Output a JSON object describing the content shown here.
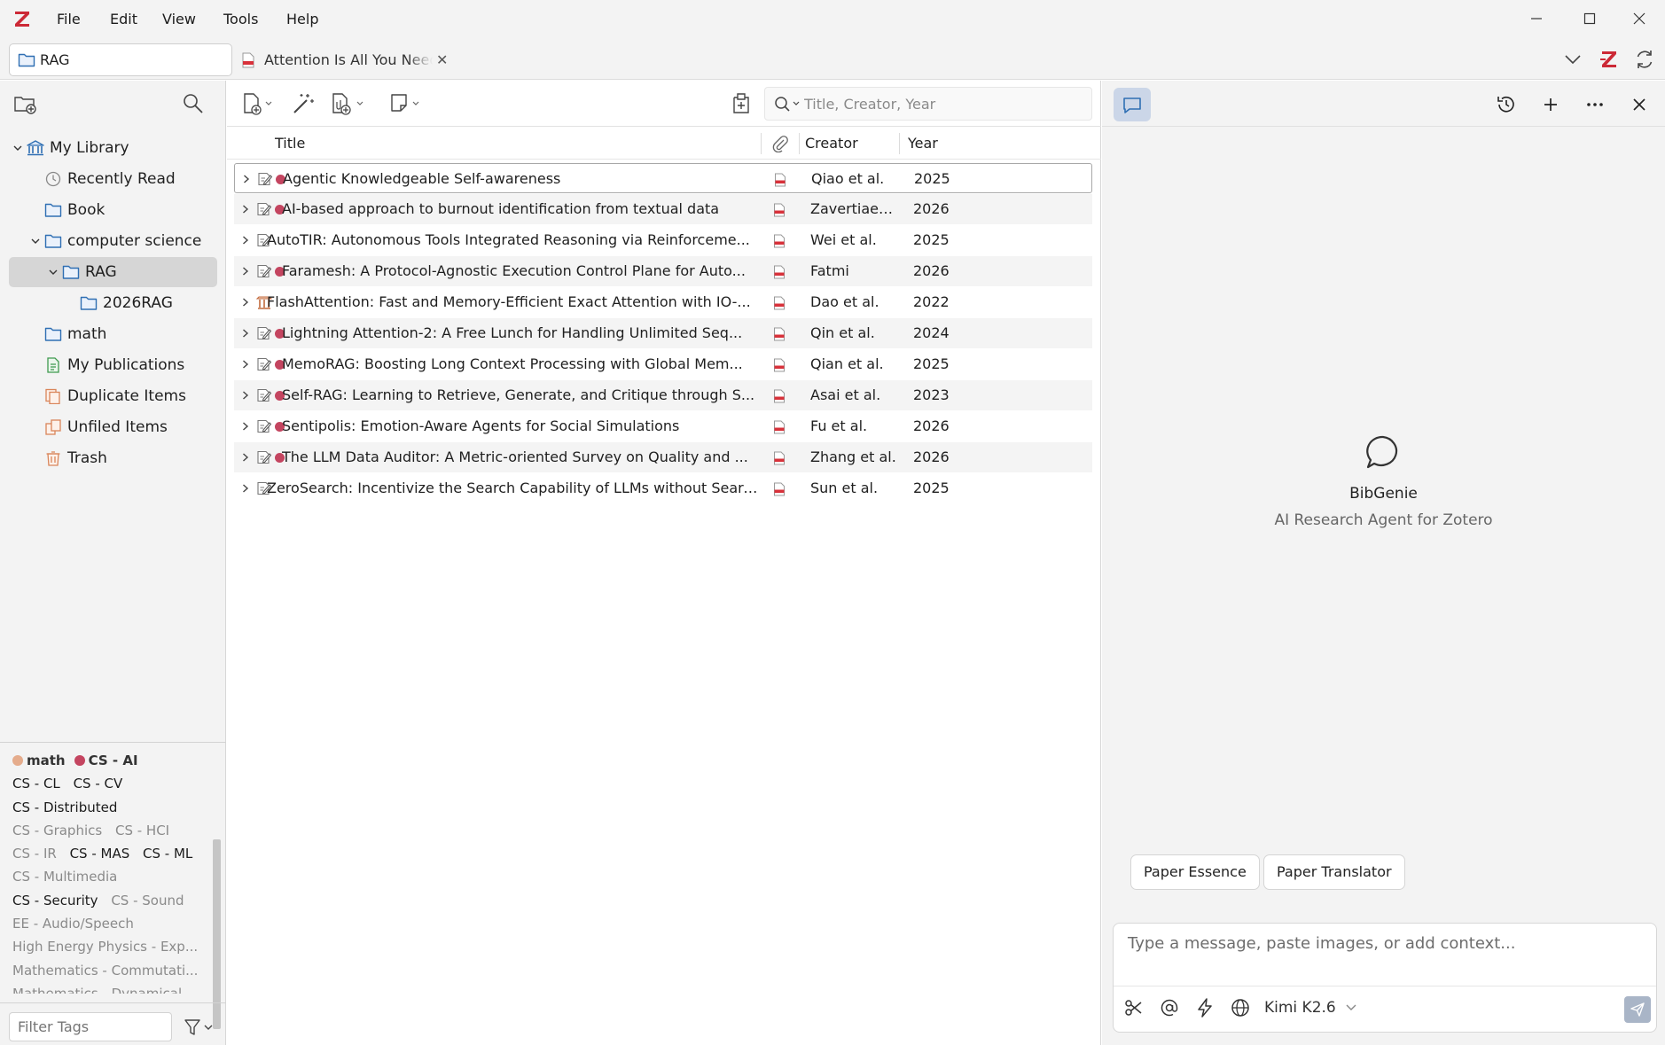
{
  "app": {
    "menus": [
      "File",
      "Edit",
      "View",
      "Tools",
      "Help"
    ]
  },
  "tabs": {
    "library_tab": "RAG",
    "reader_tab": "Attention Is All You Need",
    "reader_close": "✕"
  },
  "collections": [
    {
      "label": "My Library",
      "icon": "library-icon",
      "twisty": "expanded"
    },
    {
      "label": "Recently Read",
      "icon": "clock-icon"
    },
    {
      "label": "Book",
      "icon": "folder-icon"
    },
    {
      "label": "computer science",
      "icon": "folder-icon",
      "twisty": "expanded"
    },
    {
      "label": "RAG",
      "icon": "folder-icon",
      "twisty": "expanded",
      "selected": true
    },
    {
      "label": "2026RAG",
      "icon": "folder-icon"
    },
    {
      "label": "math",
      "icon": "folder-icon"
    },
    {
      "label": "My Publications",
      "icon": "publications-icon"
    },
    {
      "label": "Duplicate Items",
      "icon": "duplicate-icon"
    },
    {
      "label": "Unfiled Items",
      "icon": "unfiled-icon"
    },
    {
      "label": "Trash",
      "icon": "trash-icon"
    }
  ],
  "tags": {
    "colored": [
      {
        "label": "math",
        "color": "#e5ac8c"
      },
      {
        "label": "CS - AI",
        "color": "#c44560"
      }
    ],
    "items": [
      {
        "label": "CS - CL",
        "state": "on"
      },
      {
        "label": "CS - CV",
        "state": "on"
      },
      {
        "label": "CS - Distributed",
        "state": "on"
      },
      {
        "label": "CS - Graphics",
        "state": "off"
      },
      {
        "label": "CS - HCI",
        "state": "off"
      },
      {
        "label": "CS - IR",
        "state": "off"
      },
      {
        "label": "CS - MAS",
        "state": "on"
      },
      {
        "label": "CS - ML",
        "state": "on"
      },
      {
        "label": "CS - Multimedia",
        "state": "off"
      },
      {
        "label": "CS - Security",
        "state": "on"
      },
      {
        "label": "CS - Sound",
        "state": "off"
      },
      {
        "label": "EE - Audio/Speech",
        "state": "off"
      },
      {
        "label": "High Energy Physics - Exp...",
        "state": "off"
      },
      {
        "label": "Mathematics - Commutati...",
        "state": "off"
      },
      {
        "label": "Mathematics - Dynamical",
        "state": "off"
      }
    ],
    "filter_placeholder": "Filter Tags"
  },
  "search": {
    "placeholder": "Title, Creator, Year"
  },
  "columns": {
    "title": "Title",
    "creator": "Creator",
    "year": "Year"
  },
  "items": [
    {
      "title": "Agentic Knowledgeable Self-awareness",
      "creator": "Qiao et al.",
      "year": "2025",
      "tag_color": "#c44560",
      "type": "preprint"
    },
    {
      "title": "AI-based approach to burnout identification from textual data",
      "creator": "Zavertiaev...",
      "year": "2026",
      "tag_color": "#c44560",
      "type": "preprint"
    },
    {
      "title": "AutoTIR: Autonomous Tools Integrated Reasoning via Reinforceme...",
      "creator": "Wei et al.",
      "year": "2025",
      "tag_color": null,
      "type": "preprint"
    },
    {
      "title": "Faramesh: A Protocol-Agnostic Execution Control Plane for Auto...",
      "creator": "Fatmi",
      "year": "2026",
      "tag_color": "#c44560",
      "type": "preprint"
    },
    {
      "title": "FlashAttention: Fast and Memory-Efficient Exact Attention with IO-...",
      "creator": "Dao et al.",
      "year": "2022",
      "tag_color": null,
      "type": "conference"
    },
    {
      "title": "Lightning Attention-2: A Free Lunch for Handling Unlimited Seq...",
      "creator": "Qin et al.",
      "year": "2024",
      "tag_color": "#c44560",
      "type": "preprint"
    },
    {
      "title": "MemoRAG: Boosting Long Context Processing with Global Mem...",
      "creator": "Qian et al.",
      "year": "2025",
      "tag_color": "#c44560",
      "type": "preprint"
    },
    {
      "title": "Self-RAG: Learning to Retrieve, Generate, and Critique through S...",
      "creator": "Asai et al.",
      "year": "2023",
      "tag_color": "#c44560",
      "type": "preprint"
    },
    {
      "title": "Sentipolis: Emotion-Aware Agents for Social Simulations",
      "creator": "Fu et al.",
      "year": "2026",
      "tag_color": "#c44560",
      "type": "preprint"
    },
    {
      "title": "The LLM Data Auditor: A Metric-oriented Survey on Quality and ...",
      "creator": "Zhang et al.",
      "year": "2026",
      "tag_color": "#c44560",
      "type": "preprint"
    },
    {
      "title": "ZeroSearch: Incentivize the Search Capability of LLMs without Searc...",
      "creator": "Sun et al.",
      "year": "2025",
      "tag_color": null,
      "type": "preprint"
    }
  ],
  "assistant": {
    "name": "BibGenie",
    "subtitle": "AI Research Agent for Zotero",
    "chips": [
      "Paper Essence",
      "Paper Translator"
    ],
    "input_placeholder": "Type a message, paste images, or add context...",
    "model": "Kimi K2.6"
  },
  "colors": {
    "accent": "#2f6fb3",
    "tag_red": "#c44560",
    "tag_orange": "#e5ac8c",
    "selection": "#d6d6d6",
    "zotero_red": "#cc2936"
  }
}
